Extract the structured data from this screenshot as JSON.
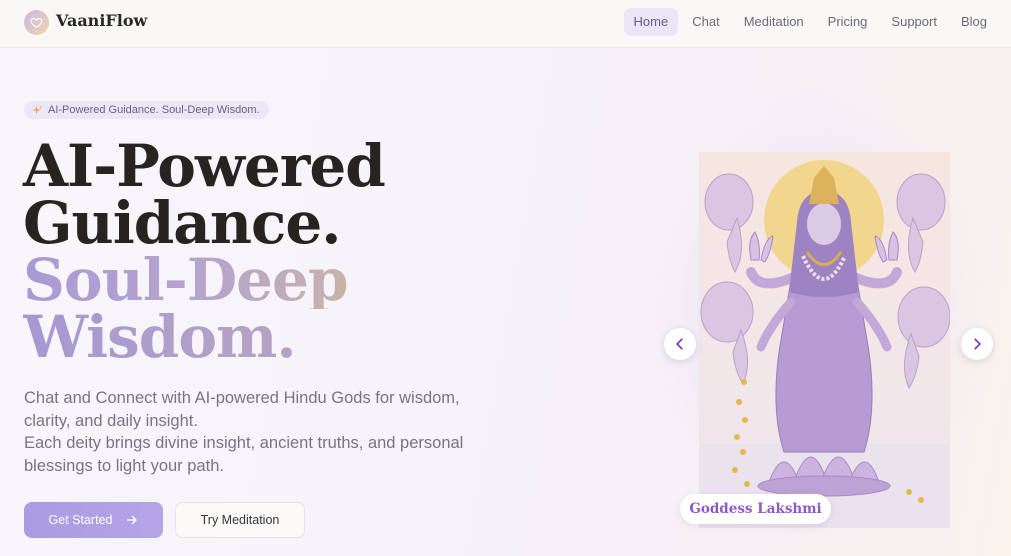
{
  "brand": {
    "name": "VaaniFlow",
    "logo_icon": "heart-icon"
  },
  "nav": {
    "items": [
      {
        "label": "Home",
        "active": true
      },
      {
        "label": "Chat"
      },
      {
        "label": "Meditation"
      },
      {
        "label": "Pricing"
      },
      {
        "label": "Support"
      },
      {
        "label": "Blog"
      }
    ]
  },
  "hero": {
    "badge_icon": "sparkles-icon",
    "badge": "AI-Powered Guidance. Soul-Deep Wisdom.",
    "title_line1": "AI-Powered",
    "title_line2": "Guidance.",
    "title_line3": "Soul-Deep",
    "title_line4": "Wisdom.",
    "description_1": "Chat and Connect with AI-powered Hindu Gods for wisdom, clarity, and daily insight.",
    "description_2": "Each deity brings divine insight, ancient truths, and personal blessings to light your path.",
    "primary_button": "Get Started",
    "primary_button_icon": "arrow-right-icon",
    "secondary_button": "Try Meditation"
  },
  "carousel": {
    "caption": "Goddess Lakshmi",
    "prev_icon": "chevron-left-icon",
    "next_icon": "chevron-right-icon"
  },
  "colors": {
    "accent": "#a99be0",
    "caption_text": "#8b5cc9",
    "active_nav_bg": "#ebe5f8"
  }
}
